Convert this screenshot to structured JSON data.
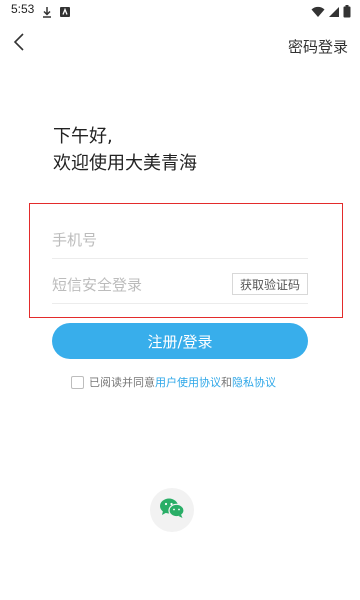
{
  "status_bar": {
    "time": "5:53",
    "left_icons": [
      "download-icon",
      "app-notification-icon"
    ],
    "right_icons": [
      "wifi-icon",
      "signal-icon",
      "battery-icon"
    ]
  },
  "header": {
    "back_icon": "chevron-left-icon",
    "password_login_label": "密码登录"
  },
  "greeting": {
    "line1": "下午好,",
    "line2": "欢迎使用大美青海"
  },
  "form": {
    "phone_placeholder": "手机号",
    "code_placeholder": "短信安全登录",
    "get_code_label": "获取验证码",
    "submit_label": "注册/登录"
  },
  "agreement": {
    "prefix": "已阅读并同意",
    "user_agreement": "用户使用协议",
    "conjunction": "和",
    "privacy_policy": "隐私协议"
  },
  "third_party": {
    "wechat_icon": "wechat-icon"
  },
  "colors": {
    "accent": "#38aeeb",
    "highlight_border": "#e32b2b",
    "link": "#2ea7e8",
    "wechat": "#2aae67"
  }
}
